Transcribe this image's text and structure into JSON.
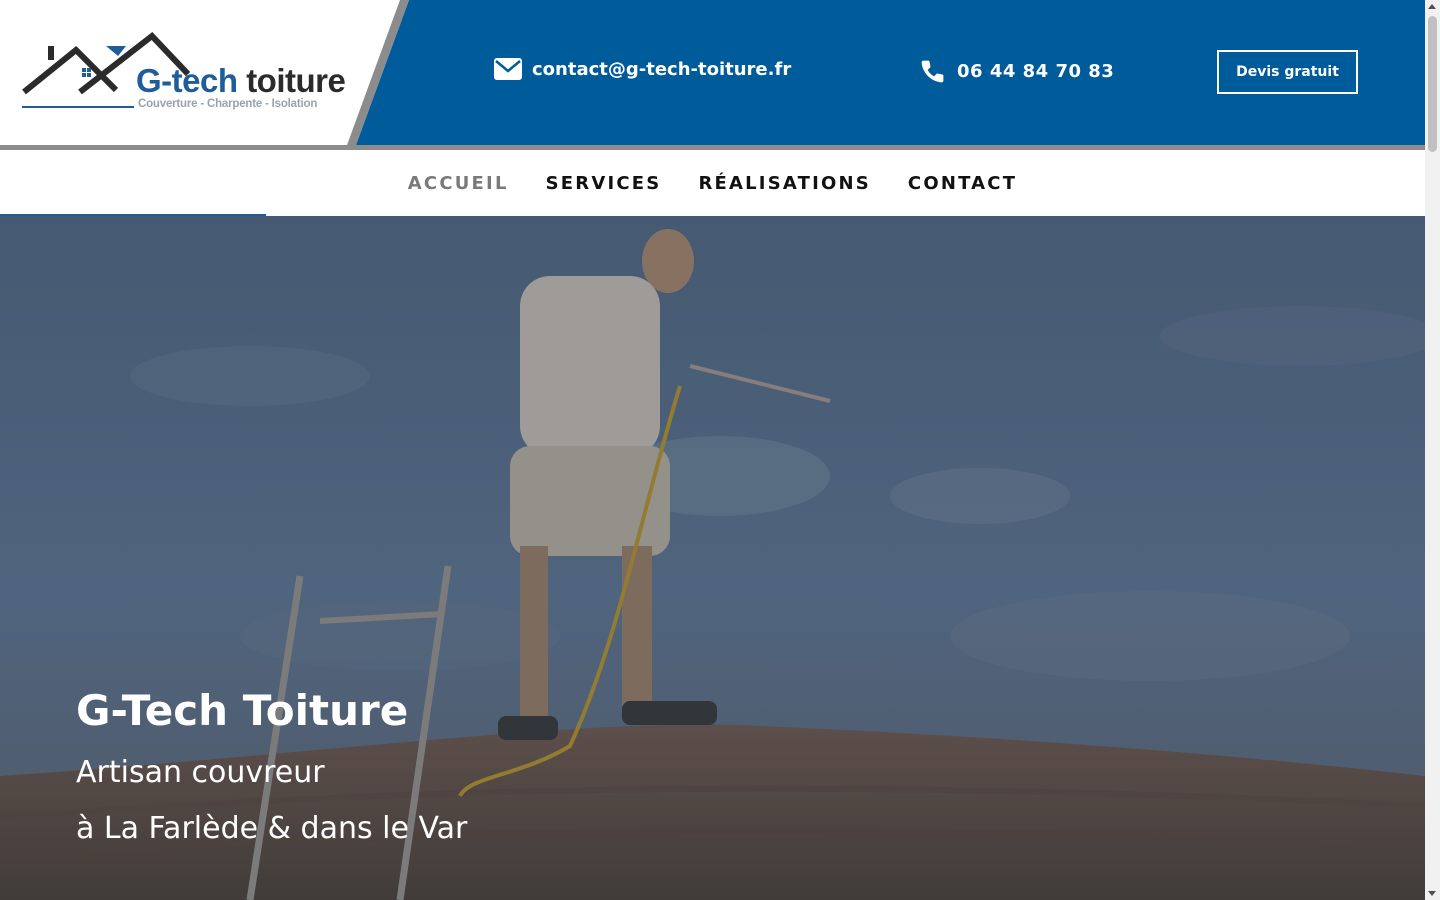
{
  "header": {
    "logo": {
      "brand_part1": "G-tech",
      "brand_part2": "toiture",
      "tagline": "Couverture - Charpente - Isolation"
    },
    "email": "contact@g-tech-toiture.fr",
    "phone": "06 44 84 70 83",
    "cta_label": "Devis gratuit",
    "icons": {
      "email": "envelope-icon",
      "phone": "phone-icon"
    }
  },
  "nav": {
    "items": [
      {
        "label": "ACCUEIL",
        "active": true
      },
      {
        "label": "SERVICES",
        "active": false
      },
      {
        "label": "RÉALISATIONS",
        "active": false
      },
      {
        "label": "CONTACT",
        "active": false
      }
    ]
  },
  "hero": {
    "title": "G-Tech Toiture",
    "subtitle_line1": "Artisan couvreur",
    "subtitle_line2": "à La Farlède & dans le Var"
  },
  "colors": {
    "brand_blue": "#005b9a",
    "logo_blue": "#1f5c9a",
    "nav_active": "#7a7a7a",
    "nav_text": "#111111"
  }
}
